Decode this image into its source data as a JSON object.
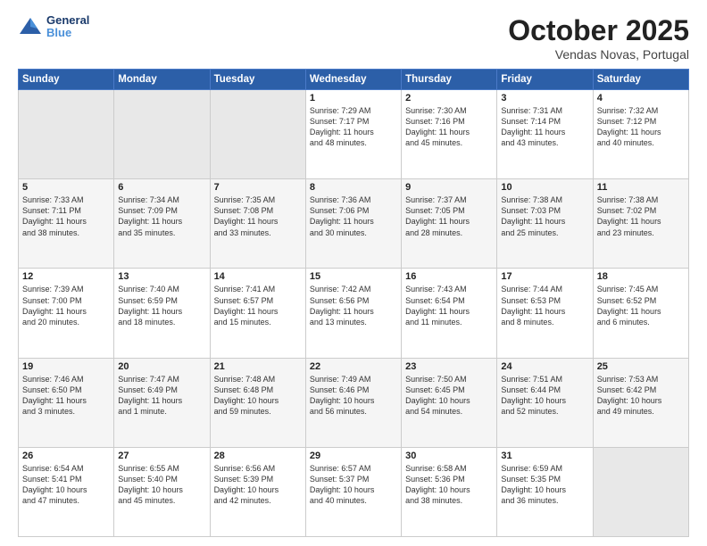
{
  "header": {
    "logo_line1": "General",
    "logo_line2": "Blue",
    "title": "October 2025",
    "subtitle": "Vendas Novas, Portugal"
  },
  "weekdays": [
    "Sunday",
    "Monday",
    "Tuesday",
    "Wednesday",
    "Thursday",
    "Friday",
    "Saturday"
  ],
  "weeks": [
    [
      {
        "day": "",
        "info": ""
      },
      {
        "day": "",
        "info": ""
      },
      {
        "day": "",
        "info": ""
      },
      {
        "day": "1",
        "info": "Sunrise: 7:29 AM\nSunset: 7:17 PM\nDaylight: 11 hours\nand 48 minutes."
      },
      {
        "day": "2",
        "info": "Sunrise: 7:30 AM\nSunset: 7:16 PM\nDaylight: 11 hours\nand 45 minutes."
      },
      {
        "day": "3",
        "info": "Sunrise: 7:31 AM\nSunset: 7:14 PM\nDaylight: 11 hours\nand 43 minutes."
      },
      {
        "day": "4",
        "info": "Sunrise: 7:32 AM\nSunset: 7:12 PM\nDaylight: 11 hours\nand 40 minutes."
      }
    ],
    [
      {
        "day": "5",
        "info": "Sunrise: 7:33 AM\nSunset: 7:11 PM\nDaylight: 11 hours\nand 38 minutes."
      },
      {
        "day": "6",
        "info": "Sunrise: 7:34 AM\nSunset: 7:09 PM\nDaylight: 11 hours\nand 35 minutes."
      },
      {
        "day": "7",
        "info": "Sunrise: 7:35 AM\nSunset: 7:08 PM\nDaylight: 11 hours\nand 33 minutes."
      },
      {
        "day": "8",
        "info": "Sunrise: 7:36 AM\nSunset: 7:06 PM\nDaylight: 11 hours\nand 30 minutes."
      },
      {
        "day": "9",
        "info": "Sunrise: 7:37 AM\nSunset: 7:05 PM\nDaylight: 11 hours\nand 28 minutes."
      },
      {
        "day": "10",
        "info": "Sunrise: 7:38 AM\nSunset: 7:03 PM\nDaylight: 11 hours\nand 25 minutes."
      },
      {
        "day": "11",
        "info": "Sunrise: 7:38 AM\nSunset: 7:02 PM\nDaylight: 11 hours\nand 23 minutes."
      }
    ],
    [
      {
        "day": "12",
        "info": "Sunrise: 7:39 AM\nSunset: 7:00 PM\nDaylight: 11 hours\nand 20 minutes."
      },
      {
        "day": "13",
        "info": "Sunrise: 7:40 AM\nSunset: 6:59 PM\nDaylight: 11 hours\nand 18 minutes."
      },
      {
        "day": "14",
        "info": "Sunrise: 7:41 AM\nSunset: 6:57 PM\nDaylight: 11 hours\nand 15 minutes."
      },
      {
        "day": "15",
        "info": "Sunrise: 7:42 AM\nSunset: 6:56 PM\nDaylight: 11 hours\nand 13 minutes."
      },
      {
        "day": "16",
        "info": "Sunrise: 7:43 AM\nSunset: 6:54 PM\nDaylight: 11 hours\nand 11 minutes."
      },
      {
        "day": "17",
        "info": "Sunrise: 7:44 AM\nSunset: 6:53 PM\nDaylight: 11 hours\nand 8 minutes."
      },
      {
        "day": "18",
        "info": "Sunrise: 7:45 AM\nSunset: 6:52 PM\nDaylight: 11 hours\nand 6 minutes."
      }
    ],
    [
      {
        "day": "19",
        "info": "Sunrise: 7:46 AM\nSunset: 6:50 PM\nDaylight: 11 hours\nand 3 minutes."
      },
      {
        "day": "20",
        "info": "Sunrise: 7:47 AM\nSunset: 6:49 PM\nDaylight: 11 hours\nand 1 minute."
      },
      {
        "day": "21",
        "info": "Sunrise: 7:48 AM\nSunset: 6:48 PM\nDaylight: 10 hours\nand 59 minutes."
      },
      {
        "day": "22",
        "info": "Sunrise: 7:49 AM\nSunset: 6:46 PM\nDaylight: 10 hours\nand 56 minutes."
      },
      {
        "day": "23",
        "info": "Sunrise: 7:50 AM\nSunset: 6:45 PM\nDaylight: 10 hours\nand 54 minutes."
      },
      {
        "day": "24",
        "info": "Sunrise: 7:51 AM\nSunset: 6:44 PM\nDaylight: 10 hours\nand 52 minutes."
      },
      {
        "day": "25",
        "info": "Sunrise: 7:53 AM\nSunset: 6:42 PM\nDaylight: 10 hours\nand 49 minutes."
      }
    ],
    [
      {
        "day": "26",
        "info": "Sunrise: 6:54 AM\nSunset: 5:41 PM\nDaylight: 10 hours\nand 47 minutes."
      },
      {
        "day": "27",
        "info": "Sunrise: 6:55 AM\nSunset: 5:40 PM\nDaylight: 10 hours\nand 45 minutes."
      },
      {
        "day": "28",
        "info": "Sunrise: 6:56 AM\nSunset: 5:39 PM\nDaylight: 10 hours\nand 42 minutes."
      },
      {
        "day": "29",
        "info": "Sunrise: 6:57 AM\nSunset: 5:37 PM\nDaylight: 10 hours\nand 40 minutes."
      },
      {
        "day": "30",
        "info": "Sunrise: 6:58 AM\nSunset: 5:36 PM\nDaylight: 10 hours\nand 38 minutes."
      },
      {
        "day": "31",
        "info": "Sunrise: 6:59 AM\nSunset: 5:35 PM\nDaylight: 10 hours\nand 36 minutes."
      },
      {
        "day": "",
        "info": ""
      }
    ]
  ]
}
